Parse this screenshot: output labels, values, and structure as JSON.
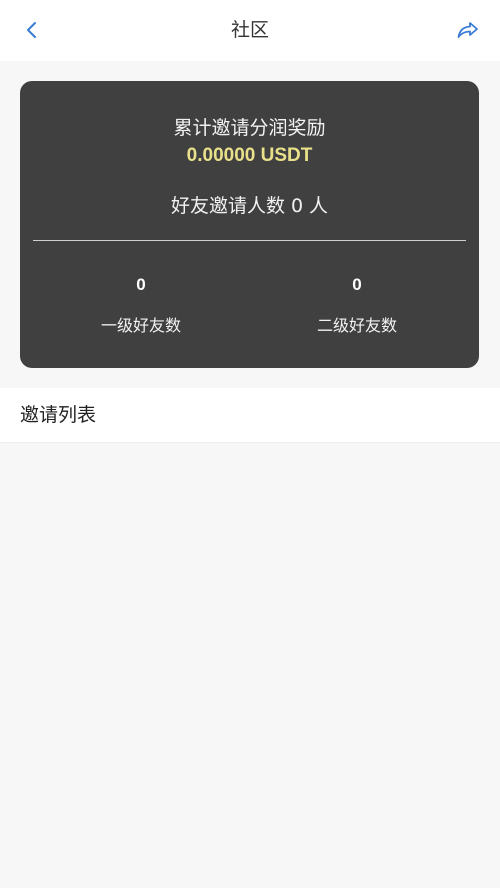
{
  "header": {
    "title": "社区",
    "back_icon": "chevron-left-icon",
    "share_icon": "share-icon"
  },
  "summary": {
    "reward_label": "累计邀请分润奖励",
    "reward_value": "0.00000 USDT",
    "invite_label": "好友邀请人数",
    "invite_count": "0",
    "invite_unit": "人",
    "level1_count": "0",
    "level1_label": "一级好友数",
    "level2_count": "0",
    "level2_label": "二级好友数"
  },
  "invite_list": {
    "title": "邀请列表"
  },
  "colors": {
    "accent": "#3a7bd5",
    "card_bg": "#404040",
    "reward_value": "#e9e18a",
    "page_bg": "#f7f7f7"
  }
}
